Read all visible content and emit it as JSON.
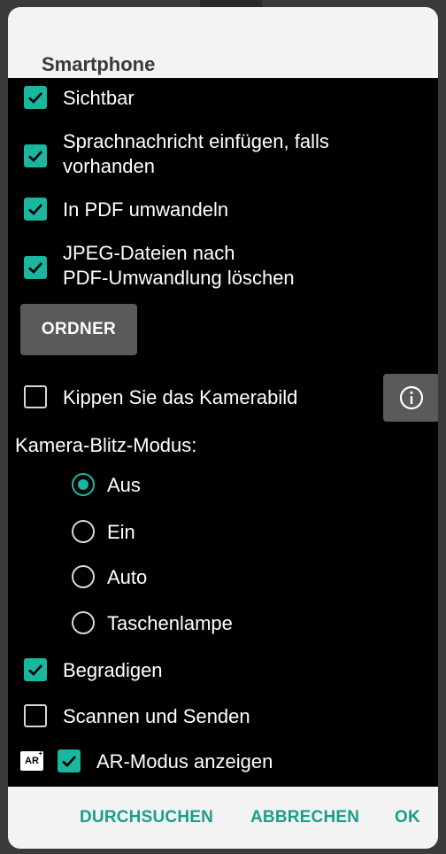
{
  "dialog": {
    "title": "Smartphone",
    "accent": "#19b6a0"
  },
  "options": {
    "sichtbar": {
      "label": "Sichtbar",
      "checked": true
    },
    "sprachnachricht": {
      "label_line1": "Sprachnachricht einfügen, falls",
      "label_line2": "vorhanden",
      "checked": true
    },
    "pdf": {
      "label": "In PDF umwandeln",
      "checked": true
    },
    "jpeg": {
      "label_line1": "JPEG-Dateien nach",
      "label_line2": "PDF-Umwandlung löschen",
      "checked": true
    },
    "ordner_button": "ORDNER",
    "kippen": {
      "label": "Kippen Sie das Kamerabild",
      "checked": false,
      "info_icon": "info-icon"
    },
    "blitz": {
      "label": "Kamera-Blitz-Modus:",
      "options": [
        "Aus",
        "Ein",
        "Auto",
        "Taschenlampe"
      ],
      "selected": "Aus"
    },
    "begradigen": {
      "label": "Begradigen",
      "checked": true
    },
    "scannen": {
      "label": "Scannen und Senden",
      "checked": false
    },
    "ar": {
      "badge": "AR",
      "badge_sup": "+",
      "label": "AR-Modus anzeigen",
      "checked": true
    }
  },
  "footer": {
    "browse": "DURCHSUCHEN",
    "cancel": "ABBRECHEN",
    "ok": "OK"
  }
}
